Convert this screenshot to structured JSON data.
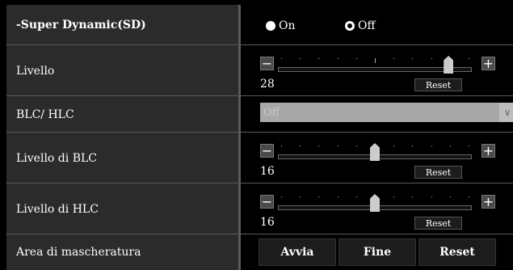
{
  "super_dynamic": {
    "label": "-Super Dynamic(SD)",
    "on_label": "On",
    "off_label": "Off",
    "selected": "Off"
  },
  "livello": {
    "label": "Livello",
    "value": "28",
    "level_fraction": 0.88,
    "reset_label": "Reset"
  },
  "blc_hlc": {
    "label": "BLC/ HLC",
    "value": "Off"
  },
  "livello_blc": {
    "label": "Livello di BLC",
    "value": "16",
    "level_fraction": 0.5,
    "reset_label": "Reset"
  },
  "livello_hlc": {
    "label": "Livello di HLC",
    "value": "16",
    "level_fraction": 0.5,
    "reset_label": "Reset"
  },
  "area_mascheratura": {
    "label": "Area di mascheratura",
    "start_label": "Avvia",
    "end_label": "Fine",
    "reset_label": "Reset"
  },
  "icons": {
    "minus": "minus-icon",
    "plus": "plus-icon",
    "chevron": "chevron-down-icon"
  },
  "colors": {
    "background": "#000000",
    "label_bg": "#2b2b2b",
    "divider": "#5a5a5a"
  }
}
